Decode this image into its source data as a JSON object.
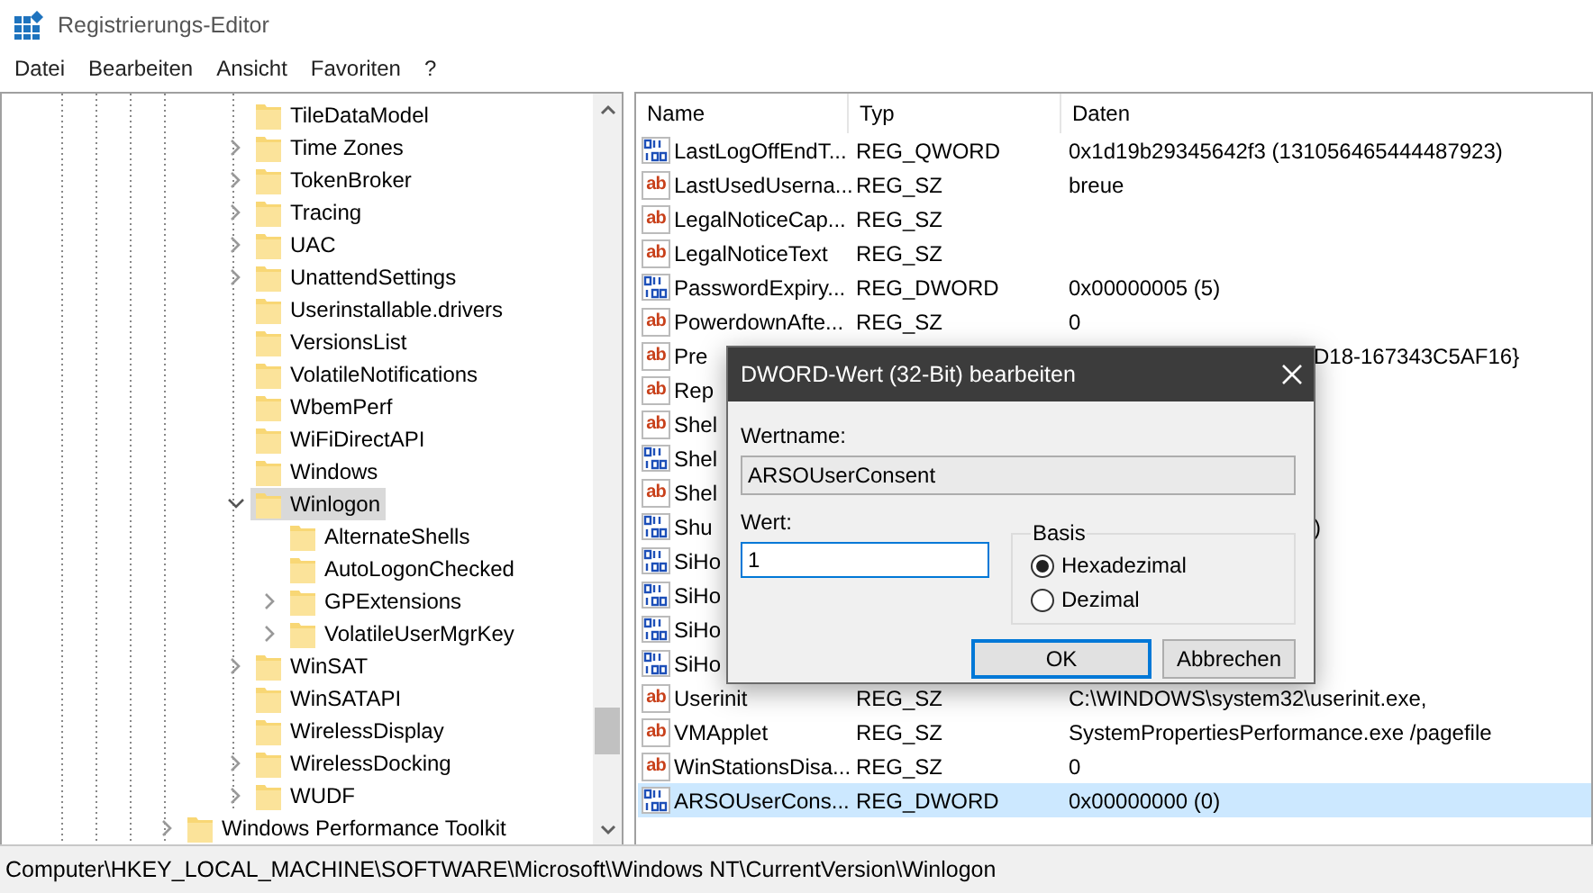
{
  "window": {
    "title": "Registrierungs-Editor"
  },
  "menu": [
    "Datei",
    "Bearbeiten",
    "Ansicht",
    "Favoriten",
    "?"
  ],
  "tree": {
    "nodes": [
      {
        "children": [
          {
            "children": [
              {
                "label": "TileDataModel",
                "expandable": false,
                "selected": false
              },
              {
                "label": "Time Zones",
                "expandable": true,
                "selected": false
              },
              {
                "label": "TokenBroker",
                "expandable": true,
                "selected": false
              },
              {
                "label": "Tracing",
                "expandable": true,
                "selected": false
              },
              {
                "label": "UAC",
                "expandable": true,
                "selected": false
              },
              {
                "label": "UnattendSettings",
                "expandable": true,
                "selected": false
              },
              {
                "label": "Userinstallable.drivers",
                "expandable": false,
                "selected": false
              },
              {
                "label": "VersionsList",
                "expandable": false,
                "selected": false
              },
              {
                "label": "VolatileNotifications",
                "expandable": false,
                "selected": false
              },
              {
                "label": "WbemPerf",
                "expandable": false,
                "selected": false
              },
              {
                "label": "WiFiDirectAPI",
                "expandable": false,
                "selected": false
              },
              {
                "label": "Windows",
                "expandable": false,
                "selected": false
              },
              {
                "label": "Winlogon",
                "expandable": true,
                "expanded": true,
                "selected": true,
                "children": [
                  {
                    "label": "AlternateShells",
                    "expandable": false,
                    "selected": false
                  },
                  {
                    "label": "AutoLogonChecked",
                    "expandable": false,
                    "selected": false
                  },
                  {
                    "label": "GPExtensions",
                    "expandable": true,
                    "selected": false
                  },
                  {
                    "label": "VolatileUserMgrKey",
                    "expandable": true,
                    "selected": false
                  }
                ]
              },
              {
                "label": "WinSAT",
                "expandable": true,
                "selected": false
              },
              {
                "label": "WinSATAPI",
                "expandable": false,
                "selected": false
              },
              {
                "label": "WirelessDisplay",
                "expandable": false,
                "selected": false
              },
              {
                "label": "WirelessDocking",
                "expandable": true,
                "selected": false
              },
              {
                "label": "WUDF",
                "expandable": true,
                "selected": false
              }
            ]
          }
        ]
      },
      {
        "label": "Windows Performance Toolkit",
        "expandable": true,
        "selected": false
      }
    ]
  },
  "table": {
    "columns": [
      "Name",
      "Typ",
      "Daten"
    ],
    "rows": [
      {
        "kind": "binary",
        "name": "LastLogOffEndT...",
        "type": "REG_QWORD",
        "data": "0x1d19b29345642f3 (131056465444487923)",
        "selected": false
      },
      {
        "kind": "string",
        "icon": "ab",
        "name": "LastUsedUserna...",
        "type": "REG_SZ",
        "data": "breue",
        "selected": false
      },
      {
        "kind": "string",
        "icon": "ab",
        "name": "LegalNoticeCap...",
        "type": "REG_SZ",
        "selected": false
      },
      {
        "kind": "string",
        "icon": "ab",
        "name": "LegalNoticeText",
        "type": "REG_SZ",
        "selected": false
      },
      {
        "kind": "binary",
        "name": "PasswordExpiry...",
        "type": "REG_DWORD",
        "data": "0x00000005 (5)",
        "selected": false
      },
      {
        "kind": "string",
        "icon": "ab",
        "name": "PowerdownAfte...",
        "type": "REG_SZ",
        "data": "0",
        "selected": false
      },
      {
        "kind": "string",
        "icon": "ab",
        "name": "Pre",
        "data": "D18-167343C5AF16}",
        "selected": false
      },
      {
        "kind": "string",
        "icon": "ab",
        "name": "Rep",
        "selected": false
      },
      {
        "kind": "string",
        "icon": "ab",
        "name": "Shel",
        "selected": false
      },
      {
        "kind": "binary",
        "name": "Shel",
        "selected": false
      },
      {
        "kind": "string",
        "icon": "ab",
        "name": "Shel",
        "selected": false
      },
      {
        "kind": "binary",
        "name": "Shu",
        "data": ")",
        "selected": false
      },
      {
        "kind": "binary",
        "name": "SiHo",
        "selected": false
      },
      {
        "kind": "binary",
        "name": "SiHo",
        "selected": false
      },
      {
        "kind": "binary",
        "name": "SiHo",
        "selected": false
      },
      {
        "kind": "binary",
        "name": "SiHo",
        "selected": false
      },
      {
        "kind": "string",
        "icon": "ab",
        "name": "Userinit",
        "type": "REG_SZ",
        "data": "C:\\WINDOWS\\system32\\userinit.exe,",
        "selected": false
      },
      {
        "kind": "string",
        "icon": "ab",
        "name": "VMApplet",
        "type": "REG_SZ",
        "data": "SystemPropertiesPerformance.exe /pagefile",
        "selected": false
      },
      {
        "kind": "string",
        "icon": "ab",
        "name": "WinStationsDisa...",
        "type": "REG_SZ",
        "data": "0",
        "selected": false
      },
      {
        "kind": "binary",
        "name": "ARSOUserCons...",
        "type": "REG_DWORD",
        "data": "0x00000000 (0)",
        "selected": true
      }
    ]
  },
  "status_bar": "Computer\\HKEY_LOCAL_MACHINE\\SOFTWARE\\Microsoft\\Windows NT\\CurrentVersion\\Winlogon",
  "dialog": {
    "title": "DWORD-Wert (32-Bit) bearbeiten",
    "name_label": "Wertname:",
    "name_value": "ARSOUserConsent",
    "value_label": "Wert:",
    "value": "1",
    "base_label": "Basis",
    "bases": [
      {
        "label": "Hexadezimal",
        "selected": true
      },
      {
        "label": "Dezimal",
        "selected": false
      }
    ],
    "buttons": [
      "OK",
      "Abbrechen"
    ]
  }
}
